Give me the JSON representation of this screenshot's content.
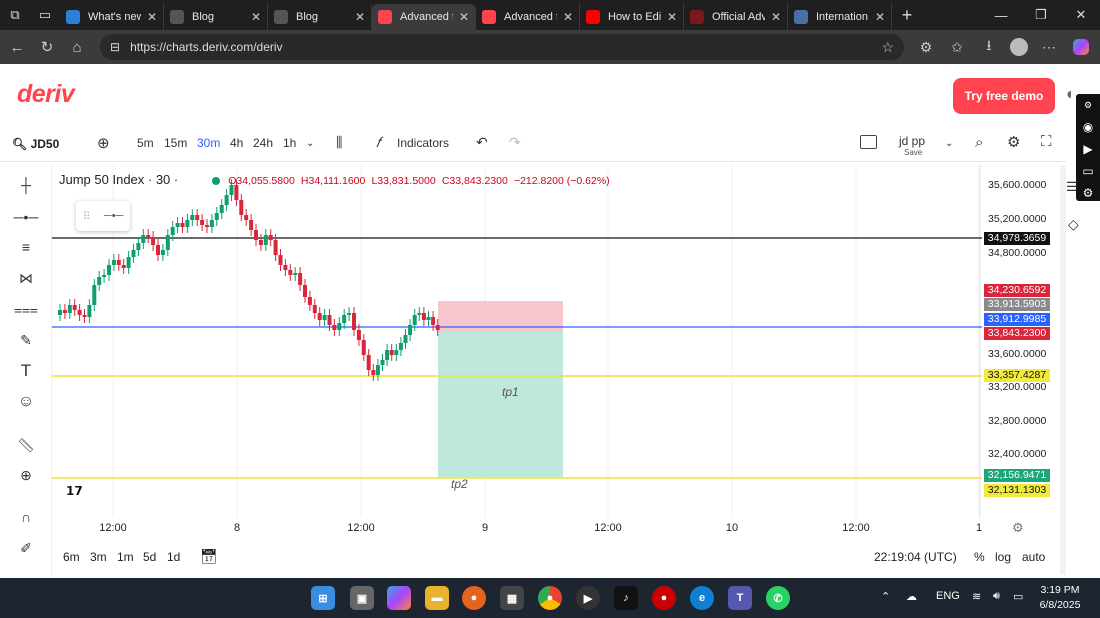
{
  "browser": {
    "tabs": [
      {
        "title": "What's new",
        "favicon": "globe-icon",
        "color": "#2b7fd6"
      },
      {
        "title": "Blog",
        "favicon": "blog-icon",
        "color": "#555"
      },
      {
        "title": "Blog",
        "favicon": "blog-icon",
        "color": "#555"
      },
      {
        "title": "Advanced t",
        "favicon": "deriv-icon",
        "color": "#ff444f",
        "active": true
      },
      {
        "title": "Advanced t",
        "favicon": "deriv-icon",
        "color": "#ff444f"
      },
      {
        "title": "How to Edi",
        "favicon": "youtube-icon",
        "color": "#ff0000"
      },
      {
        "title": "Official Adv",
        "favicon": "deriv-icon",
        "color": "#7a1a1f"
      },
      {
        "title": "Internation",
        "favicon": "doc-icon",
        "color": "#4a6fa5"
      }
    ],
    "url": "https://charts.deriv.com/deriv"
  },
  "header": {
    "logo": "deriv",
    "demo_button": "Try free demo"
  },
  "toolbar": {
    "symbol": "JD50",
    "timeframes": [
      "5m",
      "15m",
      "30m",
      "4h",
      "24h",
      "1h"
    ],
    "active_timeframe": "30m",
    "indicators": "Indicators",
    "template_name": "jd pp",
    "template_save": "Save"
  },
  "chart": {
    "title": "Jump 50 Index · 30 ·",
    "open": "O34,055.5800",
    "high": "H34,111.1600",
    "low": "L33,831.5000",
    "close": "C33,843.2300",
    "change": "−212.8200 (−0.62%)",
    "price_ticks": [
      "35,600.0000",
      "35,200.0000",
      "34,800.0000",
      "33,600.0000",
      "33,200.0000",
      "32,800.0000",
      "32,400.0000"
    ],
    "price_labels": [
      {
        "text": "34,978.3659",
        "color": "#111111"
      },
      {
        "text": "34,230.6592",
        "color": "#d9263b"
      },
      {
        "text": "33,913.5903",
        "color": "#8a8a8a"
      },
      {
        "text": "33,912.9985",
        "color": "#2962ff"
      },
      {
        "text": "33,843.2300",
        "color": "#d9263b"
      },
      {
        "text": "33,357.4287",
        "color": "#f2ea3b"
      },
      {
        "text": "32,156.9471",
        "color": "#1fa57a"
      },
      {
        "text": "32,131.1303",
        "color": "#f2ea3b"
      }
    ],
    "annotations": [
      "tp1",
      "tp2"
    ],
    "time_labels": [
      "12:00",
      "8",
      "12:00",
      "9",
      "12:00",
      "10",
      "12:00",
      "1"
    ],
    "colors": {
      "up": "#0d9f6e",
      "down": "#d9263b",
      "stop": "#f6c6cc",
      "target": "#bfe8dc"
    }
  },
  "bottom": {
    "ranges": [
      "6m",
      "3m",
      "1m",
      "5d",
      "1d"
    ],
    "time": "22:19:04 (UTC)",
    "percent": "%",
    "log": "log",
    "auto": "auto"
  },
  "taskbar": {
    "language": "ENG",
    "time": "3:19 PM",
    "date": "6/8/2025"
  }
}
